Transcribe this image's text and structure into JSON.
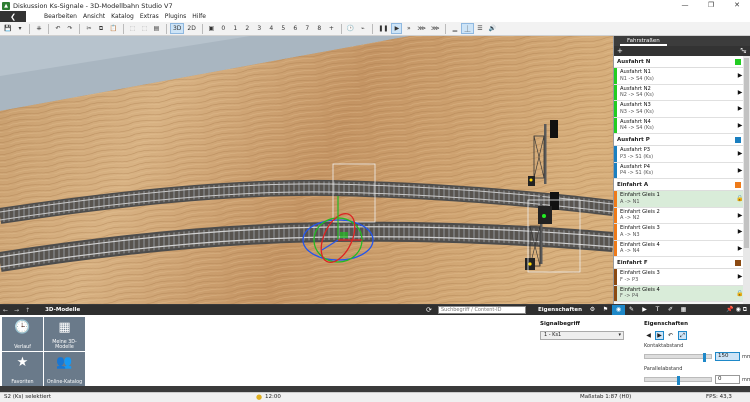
{
  "window": {
    "title": "Diskussion Ks-Signale - 3D-Modellbahn Studio V7",
    "controls": [
      "—",
      "❐",
      "✕"
    ]
  },
  "menu": {
    "back_icon": "chevron-left-icon",
    "items": [
      "Bearbeiten",
      "Ansicht",
      "Katalog",
      "Extras",
      "Plugins",
      "Hilfe"
    ]
  },
  "toolbar": {
    "view_3d": "3D",
    "view_2d": "2D",
    "cameras": [
      "0",
      "1",
      "2",
      "3",
      "4",
      "5",
      "6",
      "7",
      "8"
    ],
    "add": "+"
  },
  "routes_panel": {
    "tab": "Fahrstraßen",
    "add": "+",
    "remove": "−",
    "collapse": "⤡",
    "groups": [
      {
        "name": "Ausfahrt N",
        "color": "#22cc22",
        "routes": [
          {
            "name": "Ausfahrt N1",
            "sub": "N1 -> S4 (Ks)",
            "color": "#22cc22"
          },
          {
            "name": "Ausfahrt N2",
            "sub": "N2 -> S4 (Ks)",
            "color": "#22cc22"
          },
          {
            "name": "Ausfahrt N3",
            "sub": "N3 -> S4 (Ks)",
            "color": "#22cc22"
          },
          {
            "name": "Ausfahrt N4",
            "sub": "N4 -> S4 (Ks)",
            "color": "#22cc22"
          }
        ]
      },
      {
        "name": "Ausfahrt P",
        "color": "#1a7fc0",
        "routes": [
          {
            "name": "Ausfahrt P3",
            "sub": "P3 -> S1 (Ks)",
            "color": "#1a7fc0"
          },
          {
            "name": "Ausfahrt P4",
            "sub": "P4 -> S1 (Ks)",
            "color": "#1a7fc0"
          }
        ]
      },
      {
        "name": "Einfahrt A",
        "color": "#ee7b1a",
        "routes": [
          {
            "name": "Einfahrt Gleis 1",
            "sub": "A -> N1",
            "color": "#ee7b1a",
            "locked": true
          },
          {
            "name": "Einfahrt Gleis 2",
            "sub": "A -> N2",
            "color": "#ee7b1a"
          },
          {
            "name": "Einfahrt Gleis 3",
            "sub": "A -> N3",
            "color": "#ee7b1a"
          },
          {
            "name": "Einfahrt Gleis 4",
            "sub": "A -> N4",
            "color": "#ee7b1a"
          }
        ]
      },
      {
        "name": "Einfahrt F",
        "color": "#8b4a12",
        "routes": [
          {
            "name": "Einfahrt Gleis 3",
            "sub": "F -> P3",
            "color": "#8b4a12"
          },
          {
            "name": "Einfahrt Gleis 4",
            "sub": "F -> P4",
            "color": "#8b4a12",
            "locked": true
          }
        ]
      }
    ]
  },
  "models_panel": {
    "title": "3D-Modelle",
    "search_placeholder": "Suchbegriff / Content-ID",
    "categories": [
      {
        "label": "Verlauf",
        "icon": "clock-icon"
      },
      {
        "label": "Meine 3D-Modelle",
        "icon": "grid-icon"
      },
      {
        "label": "Favoriten",
        "icon": "star-icon"
      },
      {
        "label": "Online-Katalog",
        "icon": "people-icon"
      }
    ]
  },
  "properties_panel": {
    "title": "Eigenschaften",
    "signal_label": "Signalbegriff",
    "signal_value": "1 - Ks1",
    "props_label": "Eigenschaften",
    "contact_label": "Kontaktabstand",
    "contact_value": "150",
    "contact_level": 0.9,
    "parallel_label": "Parallelabstand",
    "parallel_value": "0",
    "parallel_level": 0.5,
    "unit": "mm"
  },
  "status": {
    "selection": "S2 (Ks) selektiert",
    "time": "12:00",
    "scale": "Maßstab 1:87 (H0)",
    "fps": "FPS: 43,3"
  },
  "colors": {
    "accent": "#1e88c8",
    "dark": "#2f2f2f"
  }
}
